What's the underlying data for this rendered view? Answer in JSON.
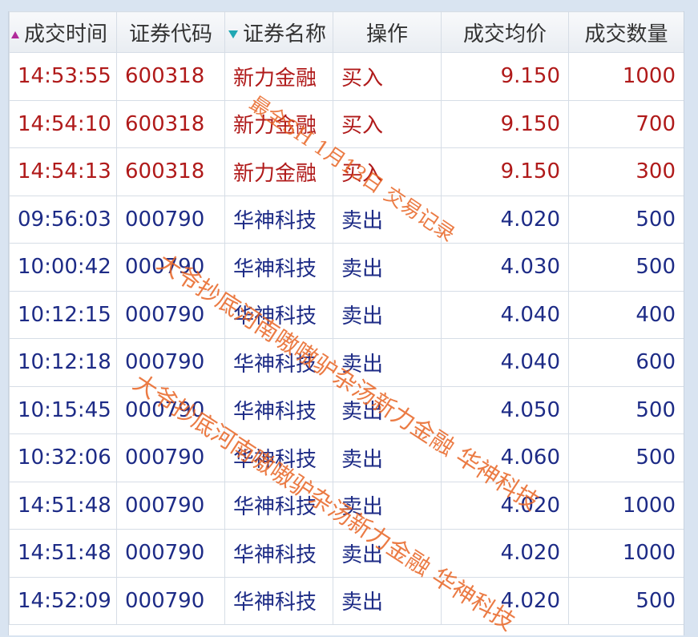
{
  "columns": {
    "time": "成交时间",
    "code": "证券代码",
    "name": "证券名称",
    "action": "操作",
    "price": "成交均价",
    "qty": "成交数量"
  },
  "sort": {
    "time_icon": "sort-ascending-icon",
    "name_icon": "sort-descending-icon"
  },
  "colors": {
    "buy": "#b01a1a",
    "sell": "#1d2b86",
    "watermark": "#e86423"
  },
  "rows": [
    {
      "time": "14:53:55",
      "code": "600318",
      "name": "新力金融",
      "action": "买入",
      "price": "9.150",
      "qty": "1000",
      "side": "buy"
    },
    {
      "time": "14:54:10",
      "code": "600318",
      "name": "新力金融",
      "action": "买入",
      "price": "9.150",
      "qty": "700",
      "side": "buy"
    },
    {
      "time": "14:54:13",
      "code": "600318",
      "name": "新力金融",
      "action": "买入",
      "price": "9.150",
      "qty": "300",
      "side": "buy"
    },
    {
      "time": "09:56:03",
      "code": "000790",
      "name": "华神科技",
      "action": "卖出",
      "price": "4.020",
      "qty": "500",
      "side": "sell"
    },
    {
      "time": "10:00:42",
      "code": "000790",
      "name": "华神科技",
      "action": "卖出",
      "price": "4.030",
      "qty": "500",
      "side": "sell"
    },
    {
      "time": "10:12:15",
      "code": "000790",
      "name": "华神科技",
      "action": "卖出",
      "price": "4.040",
      "qty": "400",
      "side": "sell"
    },
    {
      "time": "10:12:18",
      "code": "000790",
      "name": "华神科技",
      "action": "卖出",
      "price": "4.040",
      "qty": "600",
      "side": "sell"
    },
    {
      "time": "10:15:45",
      "code": "000790",
      "name": "华神科技",
      "action": "卖出",
      "price": "4.050",
      "qty": "500",
      "side": "sell"
    },
    {
      "time": "10:32:06",
      "code": "000790",
      "name": "华神科技",
      "action": "卖出",
      "price": "4.060",
      "qty": "500",
      "side": "sell"
    },
    {
      "time": "14:51:48",
      "code": "000790",
      "name": "华神科技",
      "action": "卖出",
      "price": "4.020",
      "qty": "1000",
      "side": "sell"
    },
    {
      "time": "14:51:48",
      "code": "000790",
      "name": "华神科技",
      "action": "卖出",
      "price": "4.020",
      "qty": "1000",
      "side": "sell"
    },
    {
      "time": "14:52:09",
      "code": "000790",
      "name": "华神科技",
      "action": "卖出",
      "price": "4.020",
      "qty": "500",
      "side": "sell"
    }
  ],
  "watermarks": {
    "wm1": "最全SH 1月13日 交易记录",
    "wm2": "大爷抄底河南嗷嗷驴杂汤新力金融 华神科技",
    "wm3": "大爷抄底河南嗷嗷驴杂汤新力金融 华神科技"
  }
}
